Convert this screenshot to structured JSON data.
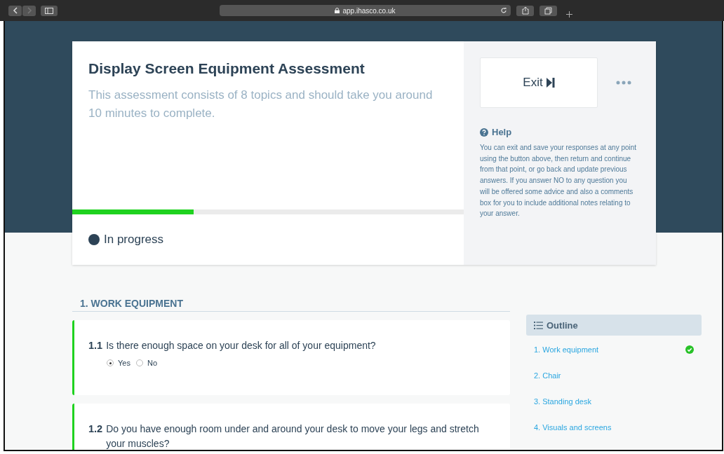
{
  "browser": {
    "address": "app.ihasco.co.uk"
  },
  "assessment": {
    "title": "Display Screen Equipment Assessment",
    "description": "This assessment consists of 8 topics and should take you around 10 minutes to complete.",
    "progress": {
      "level": 0.31
    },
    "status": "In progress"
  },
  "side_panel": {
    "exit_button": "Exit",
    "help_title": "Help",
    "help_text": "You can exit and save your responses at any point using the button above, then return and continue from that point, or go back and update previous answers. If you answer NO to any question you will be offered some advice and also a comments box for you to include additional notes relating to your answer."
  },
  "section": {
    "title": "1. WORK EQUIPMENT",
    "questions": [
      {
        "number": "1.1",
        "text": "Is there enough space on your desk for all of your equipment?",
        "options": [
          {
            "label": "Yes",
            "selected": true
          },
          {
            "label": "No",
            "selected": false
          }
        ]
      },
      {
        "number": "1.2",
        "text": "Do you have enough room under and around your desk to move your legs and stretch your muscles?"
      }
    ]
  },
  "outline": {
    "title": "Outline",
    "items": [
      {
        "label": "1. Work equipment",
        "completed": true
      },
      {
        "label": "2. Chair",
        "completed": false
      },
      {
        "label": "3. Standing desk",
        "completed": false
      },
      {
        "label": "4. Visuals and screens",
        "completed": false
      }
    ]
  }
}
